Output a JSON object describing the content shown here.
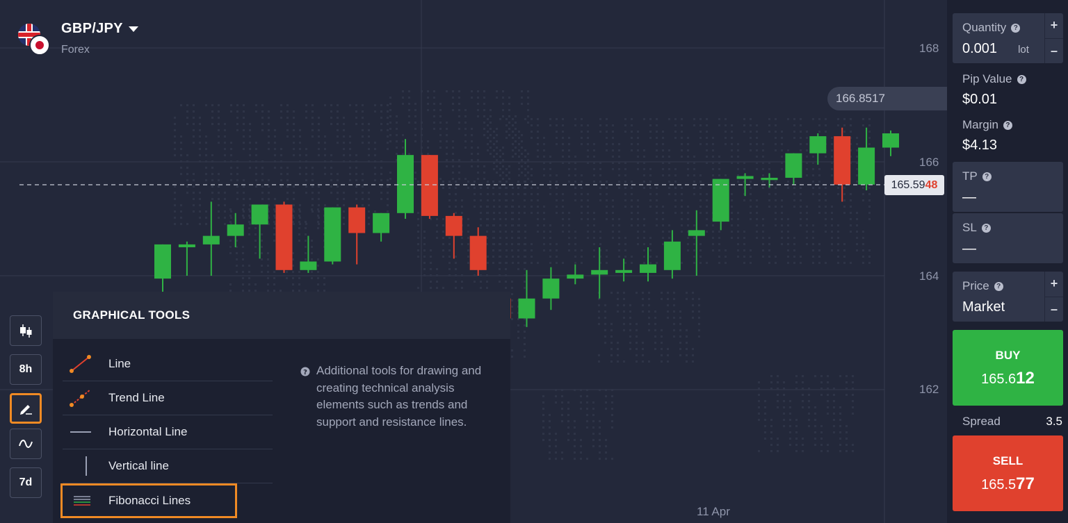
{
  "asset": {
    "name": "GBP/JPY",
    "type": "Forex"
  },
  "chart": {
    "price_axis": [
      "168",
      "166",
      "164",
      "162"
    ],
    "time_axis": [
      "11 Apr"
    ],
    "current_price_main": "165.59",
    "current_price_tail": "48",
    "tooltip_price": "166.8517",
    "colors": {
      "up": "#2fb344",
      "down": "#e0412e"
    },
    "candles": [
      {
        "o": 163.95,
        "h": 164.4,
        "l": 163.4,
        "c": 164.55
      },
      {
        "o": 164.5,
        "h": 164.6,
        "l": 164.0,
        "c": 164.55
      },
      {
        "o": 164.55,
        "h": 165.3,
        "l": 164.0,
        "c": 164.7
      },
      {
        "o": 164.7,
        "h": 165.1,
        "l": 164.5,
        "c": 164.9
      },
      {
        "o": 164.9,
        "h": 165.0,
        "l": 164.3,
        "c": 165.25
      },
      {
        "o": 165.25,
        "h": 165.3,
        "l": 164.05,
        "c": 164.1
      },
      {
        "o": 164.1,
        "h": 164.7,
        "l": 164.05,
        "c": 164.25
      },
      {
        "o": 164.25,
        "h": 164.95,
        "l": 164.2,
        "c": 165.2
      },
      {
        "o": 165.2,
        "h": 165.25,
        "l": 164.2,
        "c": 164.75
      },
      {
        "o": 164.75,
        "h": 165.1,
        "l": 164.6,
        "c": 165.1
      },
      {
        "o": 165.1,
        "h": 166.4,
        "l": 165.0,
        "c": 166.12
      },
      {
        "o": 166.12,
        "h": 166.1,
        "l": 165.0,
        "c": 165.05
      },
      {
        "o": 165.05,
        "h": 165.1,
        "l": 164.3,
        "c": 164.7
      },
      {
        "o": 164.7,
        "h": 164.85,
        "l": 164.0,
        "c": 164.1
      },
      {
        "o": 163.6,
        "h": 163.62,
        "l": 163.25,
        "c": 163.25
      },
      {
        "o": 163.25,
        "h": 164.1,
        "l": 163.1,
        "c": 163.6
      },
      {
        "o": 163.6,
        "h": 164.15,
        "l": 163.4,
        "c": 163.95
      },
      {
        "o": 163.95,
        "h": 164.2,
        "l": 163.85,
        "c": 164.02
      },
      {
        "o": 164.02,
        "h": 164.5,
        "l": 163.6,
        "c": 164.1
      },
      {
        "o": 164.05,
        "h": 164.3,
        "l": 163.9,
        "c": 164.1
      },
      {
        "o": 164.05,
        "h": 164.5,
        "l": 163.9,
        "c": 164.2
      },
      {
        "o": 164.1,
        "h": 164.8,
        "l": 163.95,
        "c": 164.6
      },
      {
        "o": 164.7,
        "h": 165.15,
        "l": 164.0,
        "c": 164.8
      },
      {
        "o": 164.95,
        "h": 165.6,
        "l": 164.8,
        "c": 165.7
      },
      {
        "o": 165.7,
        "h": 165.8,
        "l": 165.4,
        "c": 165.75
      },
      {
        "o": 165.68,
        "h": 165.8,
        "l": 165.55,
        "c": 165.72
      },
      {
        "o": 165.72,
        "h": 165.9,
        "l": 165.6,
        "c": 166.15
      },
      {
        "o": 166.15,
        "h": 166.5,
        "l": 165.95,
        "c": 166.45
      },
      {
        "o": 166.45,
        "h": 166.6,
        "l": 165.3,
        "c": 165.6
      },
      {
        "o": 165.6,
        "h": 166.6,
        "l": 165.5,
        "c": 166.25
      },
      {
        "o": 166.25,
        "h": 166.55,
        "l": 166.1,
        "c": 166.5
      }
    ]
  },
  "left_tools": {
    "candles_label": "",
    "timeframe": "8h",
    "period": "7d"
  },
  "graphical_tools": {
    "title": "GRAPHICAL TOOLS",
    "items": [
      {
        "label": "Line"
      },
      {
        "label": "Trend Line"
      },
      {
        "label": "Horizontal Line"
      },
      {
        "label": "Vertical line"
      },
      {
        "label": "Fibonacci Lines"
      }
    ],
    "description": "Additional tools for drawing and creating technical analysis elements such as trends and support and resistance lines."
  },
  "trade_panel": {
    "quantity_label": "Quantity",
    "quantity_value": "0.001",
    "quantity_unit": "lot",
    "pip_value_label": "Pip Value",
    "pip_value": "$0.01",
    "margin_label": "Margin",
    "margin_value": "$4.13",
    "tp_label": "TP",
    "tp_value": "—",
    "sl_label": "SL",
    "sl_value": "—",
    "price_label": "Price",
    "price_value": "Market",
    "buy_label": "BUY",
    "buy_price_main": "165.6",
    "buy_price_tail": "12",
    "spread_label": "Spread",
    "spread_value": "3.5",
    "sell_label": "SELL",
    "sell_price_main": "165.5",
    "sell_price_tail": "77"
  }
}
